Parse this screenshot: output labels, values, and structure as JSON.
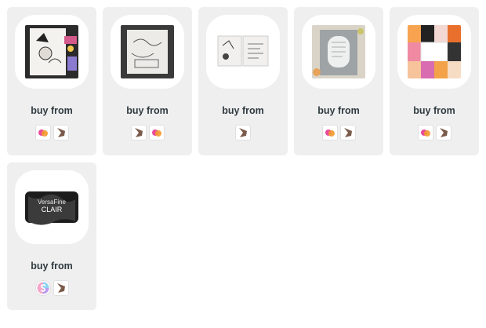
{
  "cards": [
    {
      "label": "buy from",
      "stores": [
        "flower-store-icon",
        "bird-store-icon"
      ]
    },
    {
      "label": "buy from",
      "stores": [
        "bird-store-icon",
        "flower-store-icon"
      ]
    },
    {
      "label": "buy from",
      "stores": [
        "bird-store-icon"
      ]
    },
    {
      "label": "buy from",
      "stores": [
        "flower-store-icon",
        "bird-store-icon"
      ]
    },
    {
      "label": "buy from",
      "stores": [
        "flower-store-icon",
        "bird-store-icon"
      ]
    },
    {
      "label": "buy from",
      "stores": [
        "rainbow-s-store-icon",
        "bird-store-icon"
      ]
    }
  ],
  "products": {
    "ink_pad_brand": "VersaFine",
    "ink_pad_name": "CLAIR"
  },
  "colors": {
    "card_bg": "#efefef",
    "label": "#2f3a40",
    "flower_pink": "#e84b9b",
    "flower_orange": "#f39a2d",
    "bird_brown": "#7a5a4a"
  }
}
